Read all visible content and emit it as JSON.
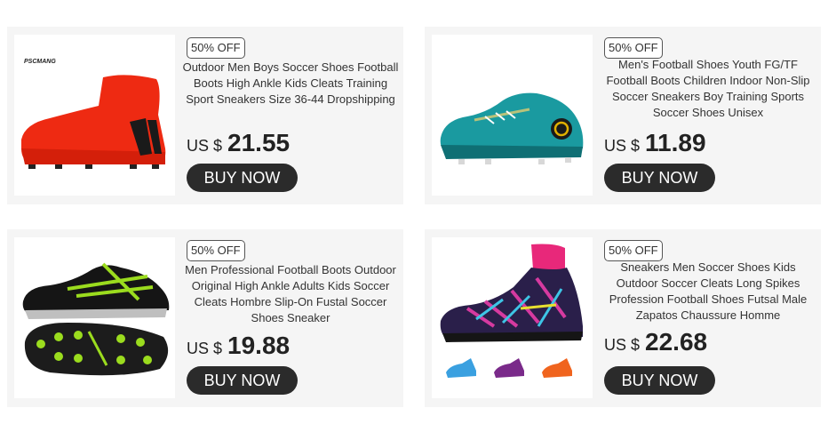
{
  "products": [
    {
      "discount": "50% OFF",
      "title": "Outdoor Men Boys Soccer Shoes Football Boots High Ankle Kids Cleats Training Sport Sneakers Size 36-44 Dropshipping",
      "currency": "US $",
      "price": "21.55",
      "button": "BUY NOW",
      "brand_mark": "PSCMANG",
      "image": "red-high-ankle-soccer-boot"
    },
    {
      "discount": "50% OFF",
      "title": "Men's Football Shoes Youth FG/TF Football Boots Children Indoor Non-Slip Soccer Sneakers Boy Training Sports Soccer Shoes Unisex",
      "currency": "US $",
      "price": "11.89",
      "button": "BUY NOW",
      "image": "teal-low-cut-soccer-cleat"
    },
    {
      "discount": "50% OFF",
      "title": "Men Professional Football Boots Outdoor Original High Ankle Adults Kids Soccer Cleats Hombre Slip-On Fustal Soccer Shoes Sneaker",
      "currency": "US $",
      "price": "19.88",
      "button": "BUY NOW",
      "image": "black-neon-soccer-cleat-with-sole"
    },
    {
      "discount": "50% OFF",
      "title": "Sneakers Men Soccer Shoes Kids Outdoor Soccer Cleats Long Spikes Profession Football Shoes Futsal Male Zapatos Chaussure Homme",
      "currency": "US $",
      "price": "22.68",
      "button": "BUY NOW",
      "image": "multicolor-sock-soccer-boot"
    }
  ]
}
